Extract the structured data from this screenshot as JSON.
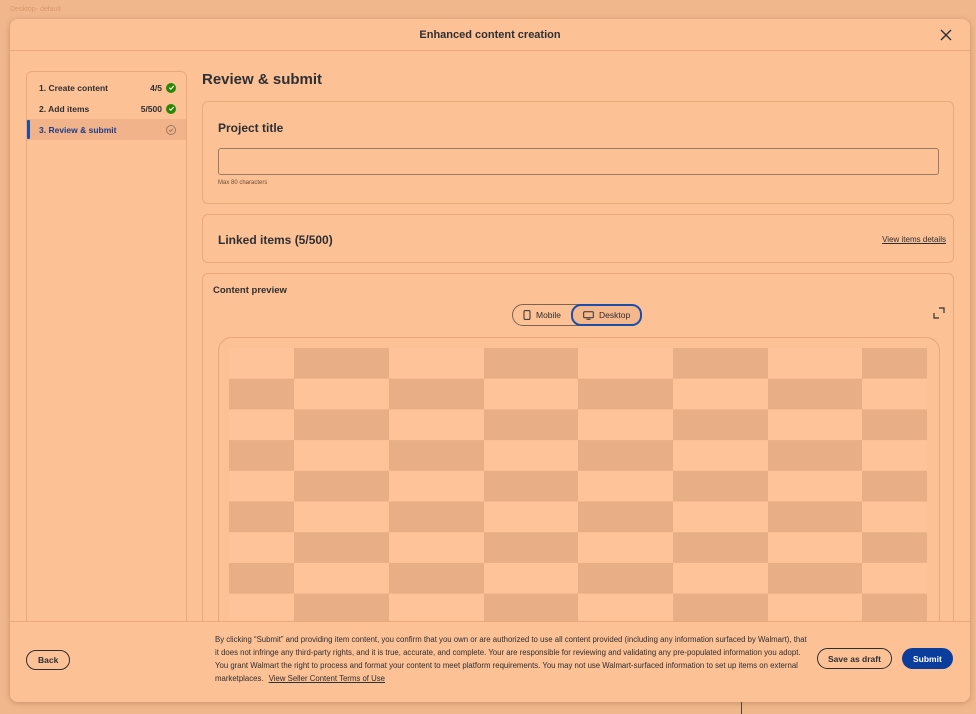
{
  "frame": {
    "label": "Desktop- default"
  },
  "modal": {
    "title": "Enhanced content creation"
  },
  "steps": [
    {
      "label": "1. Create content",
      "count": "4/5",
      "status": "complete"
    },
    {
      "label": "2. Add items",
      "count": "5/500",
      "status": "complete"
    },
    {
      "label": "3. Review & submit",
      "count": "",
      "status": "current"
    }
  ],
  "main": {
    "title": "Review & submit",
    "project": {
      "heading": "Project title",
      "value": "",
      "helper": "Max 80 characters"
    },
    "linked": {
      "heading": "Linked items (5/500)",
      "link": "View items details"
    },
    "preview": {
      "heading": "Content preview",
      "mobile_label": "Mobile",
      "desktop_label": "Desktop",
      "selected": "Desktop"
    }
  },
  "footer": {
    "back_label": "Back",
    "legal_text": "By clicking “Submit” and providing item content, you confirm that you own or are authorized to use all content  provided (including any information surfaced by Walmart), that it does not infringe any third-party rights, and it is true, accurate, and complete. Your are responsible for reviewing and validating any pre-populated information you adopt. You grant Walmart the right to process and format your content to meet platform requirements. You may not use Walmart-surfaced information to set up items on external marketplaces.",
    "legal_link": "View Seller Content Terms of Use",
    "save_draft_label": "Save as draft",
    "submit_label": "Submit"
  },
  "colors": {
    "background": "#f0b78c",
    "surface": "#fdc196",
    "primary": "#0b3e9c",
    "success": "#2a8703",
    "checker_light": "#ffc39a",
    "checker_dark": "#e8ae85"
  }
}
